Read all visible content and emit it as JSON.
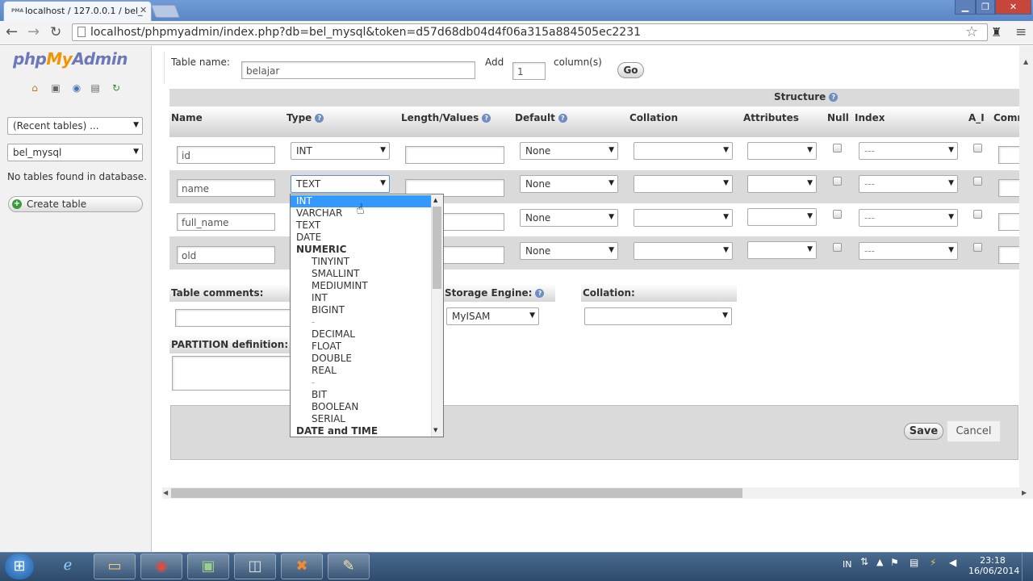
{
  "browser": {
    "tab_title": "localhost / 127.0.0.1 / bel_",
    "tab_icon_text": "PMA",
    "url": "localhost/phpmyadmin/index.php?db=bel_mysql&token=d57d68db04d4f06a315a884505ec2231"
  },
  "sidebar": {
    "logo_php": "php",
    "logo_my": "My",
    "logo_admin": "Admin",
    "recent_tables": "(Recent tables) ...",
    "database": "bel_mysql",
    "no_tables": "No tables found in database.",
    "create_table": "Create table"
  },
  "form": {
    "table_name_label": "Table name:",
    "table_name_value": "belajar",
    "add_label": "Add",
    "add_value": "1",
    "columns_label": "column(s)",
    "go_label": "Go",
    "structure_label": "Structure"
  },
  "columns_header": {
    "name": "Name",
    "type": "Type",
    "length": "Length/Values",
    "default": "Default",
    "collation": "Collation",
    "attributes": "Attributes",
    "null": "Null",
    "index": "Index",
    "ai": "A_I",
    "comments": "Comm"
  },
  "rows": [
    {
      "name": "id",
      "type": "INT",
      "length": "",
      "default": "None",
      "index": "---"
    },
    {
      "name": "name",
      "type": "TEXT",
      "length": "",
      "default": "None",
      "index": "---"
    },
    {
      "name": "full_name",
      "type": "",
      "length": "",
      "default": "None",
      "index": "---"
    },
    {
      "name": "old",
      "type": "",
      "length": "",
      "default": "None",
      "index": "---"
    }
  ],
  "type_dropdown": {
    "options": [
      "INT",
      "VARCHAR",
      "TEXT",
      "DATE",
      "NUMERIC",
      "TINYINT",
      "SMALLINT",
      "MEDIUMINT",
      "INT",
      "BIGINT",
      "-",
      "DECIMAL",
      "FLOAT",
      "DOUBLE",
      "REAL",
      "-",
      "BIT",
      "BOOLEAN",
      "SERIAL",
      "DATE and TIME"
    ],
    "selected_index": 0
  },
  "table_options": {
    "comments_label": "Table comments:",
    "storage_label": "Storage Engine:",
    "storage_value": "MyISAM",
    "collation_label": "Collation:",
    "partition_label": "PARTITION definition:"
  },
  "actions": {
    "save": "Save",
    "cancel": "Cancel"
  },
  "taskbar": {
    "lang": "IN",
    "time": "23:18",
    "date": "16/06/2014"
  },
  "colors": {
    "accent_blue": "#3399ff",
    "logo_orange": "#f29400",
    "logo_blue": "#6c78b8"
  }
}
